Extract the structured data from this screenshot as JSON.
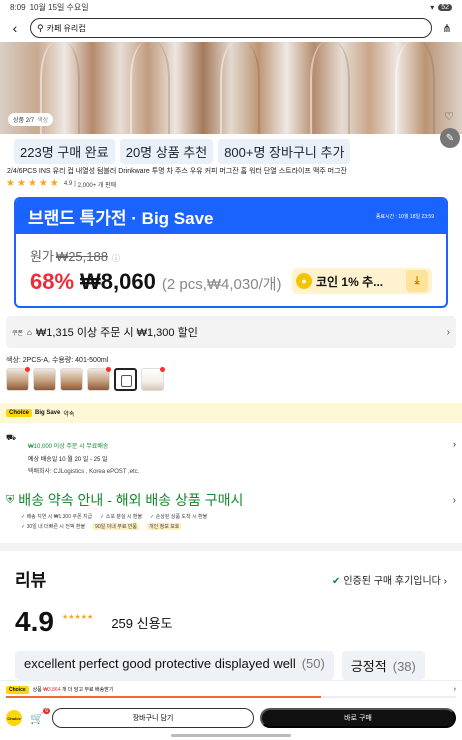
{
  "status": {
    "time": "8:09",
    "date": "10월 15일 수요일",
    "battery": "52"
  },
  "search": {
    "value": "카페 유리컵"
  },
  "hero": {
    "badge": "상품 2/7",
    "badge_sub": "색상"
  },
  "chips": [
    "223명 구매 완료",
    "20명 상품 추천",
    "800+명 장바구니 추가"
  ],
  "product": {
    "title": "2/4/6PCS INS 유리 컵 내열성 텀블러 Drinkware 투명 차 주스 우유 커피 머그잔 홈 워터 단열 스트라이프 맥주 머그잔",
    "rating": "4.9",
    "sold": "2,000+ 개 판매"
  },
  "brand": {
    "title": "브랜드 특가전 · Big Save",
    "end_time": "종료시간 : 10월 18일 23:59",
    "orig_label": "원가",
    "orig_price": "₩25,188",
    "discount": "68%",
    "price": "₩8,060",
    "unit": "(2 pcs,₩4,030/개)",
    "coin": "코인 1% 추..."
  },
  "coupon": {
    "label": "쿠폰",
    "text": "₩1,315 이상 주문 시 ₩1,300 할인"
  },
  "color": {
    "label": "색상: 2PCS-A, 수용량: 401-500ml"
  },
  "choice": {
    "tag": "Choice",
    "bigsave": "Big Save",
    "text": "약속"
  },
  "shipping": {
    "free": "₩10,000 이상 주문 시 무료배송",
    "eta": "예상 배송일 10 월 20 일 - 25 일",
    "carriers": "택배회사: CJLogistics , Korea ePOST ,etc."
  },
  "guarantee": {
    "title": "배송 약속 안내 - 해외 배송 상품 구매시",
    "row1": [
      "✓ 배송 지연 시 ₩1,300 쿠폰 지급",
      "✓ 소포 분실 시 환불",
      "✓ 손상된 상품 도착 시 환불"
    ],
    "row2": [
      "✓ 30일 내 더빠른 시 전액 환불",
      "90일 이내 무료 반품",
      "개인 정보 보호"
    ]
  },
  "review": {
    "title": "리뷰",
    "verified": "인증된 구매 후기입니다",
    "score": "4.9",
    "count": "259 신용도",
    "tags": [
      {
        "label": "excellent perfect good protective displayed well",
        "count": "(50)"
      },
      {
        "label": "긍정적",
        "count": "(38)"
      }
    ]
  },
  "strip": {
    "tag": "Choice",
    "text_a": "상품",
    "amount": "₩3,864",
    "text_b": "개 더 담고 무료 배송받기"
  },
  "bottom": {
    "cart_count": "6",
    "add_cart": "장바구니 담기",
    "buy": "바로 구매",
    "choice_mini": "Choice"
  }
}
